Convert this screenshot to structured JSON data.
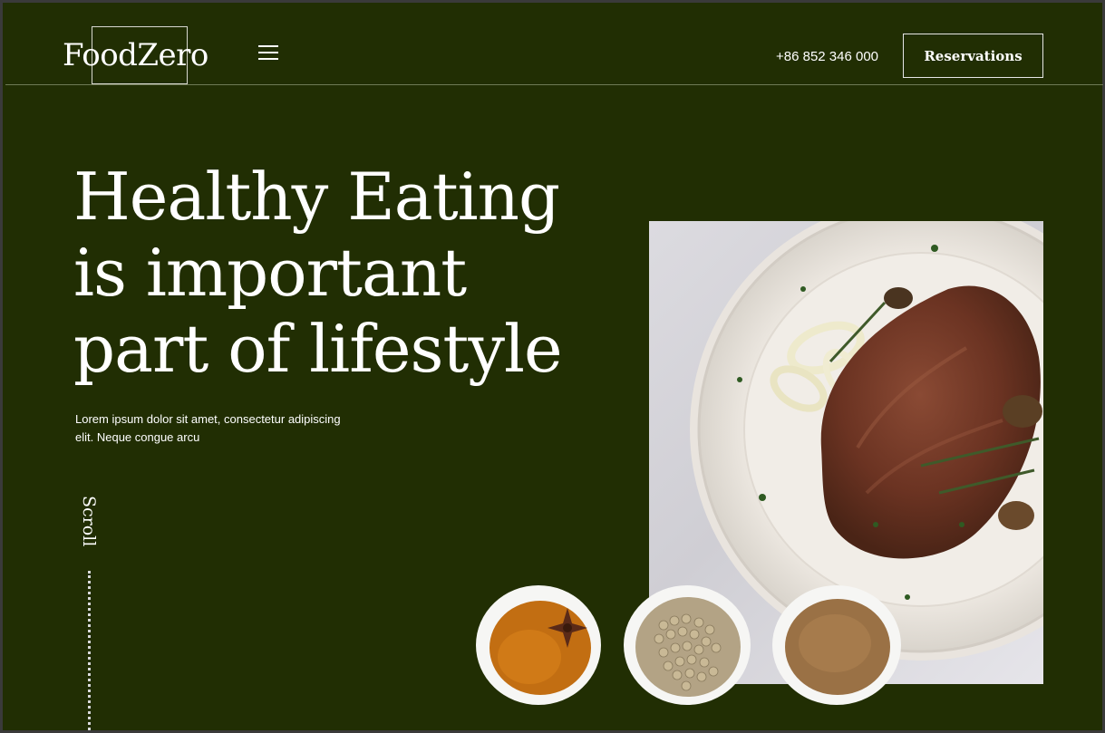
{
  "header": {
    "logo": "FoodZero",
    "menu_icon": "hamburger-menu-icon",
    "phone": "+86 852 346 000",
    "reservations_label": "Reservations"
  },
  "hero": {
    "title_lines": [
      "Healthy Eating",
      "is important",
      "part of lifestyle"
    ],
    "subtitle_lines": [
      "Lorem ipsum dolor sit amet, consectetur adipiscing",
      "elit. Neque congue arcu"
    ],
    "scroll_label": "Scroll"
  },
  "images": {
    "main": "steak-plate-image",
    "spices": [
      "turmeric-star-anise-bowl",
      "peppercorn-bowl",
      "ground-spice-bowl"
    ]
  },
  "colors": {
    "background": "#212e03",
    "text": "#ffffff",
    "divider": "#6f7a55"
  }
}
